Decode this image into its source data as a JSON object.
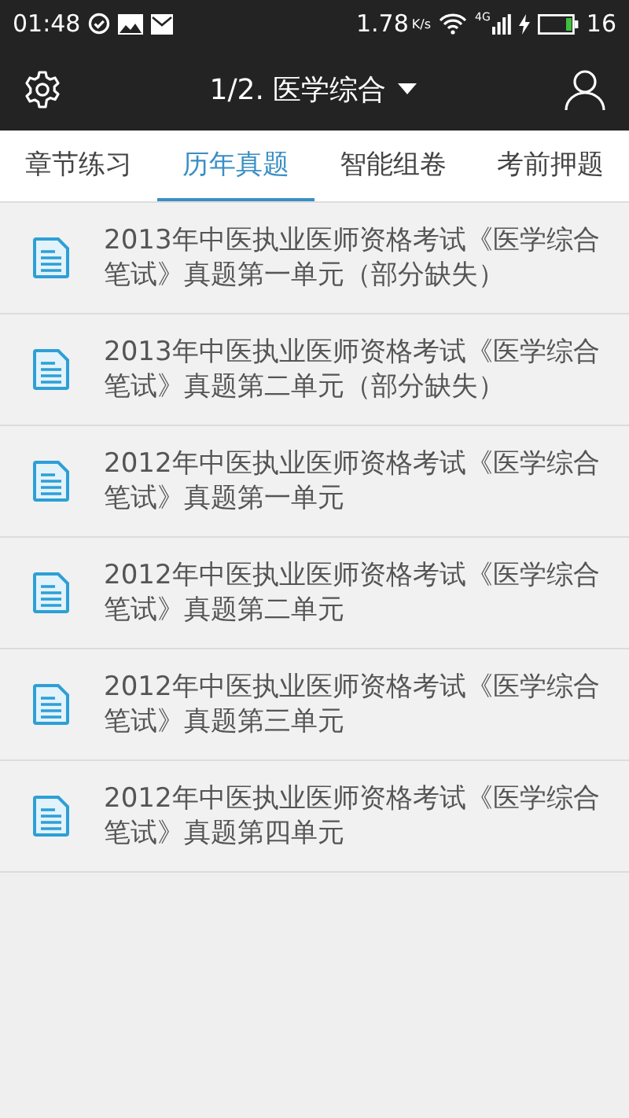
{
  "status_bar": {
    "time": "01:48",
    "speed": "1.78",
    "speed_unit": "K/s",
    "network": "4G",
    "battery": "16"
  },
  "header": {
    "title": "1/2. 医学综合"
  },
  "tabs": [
    {
      "label": "章节练习",
      "selected": false
    },
    {
      "label": "历年真题",
      "selected": true
    },
    {
      "label": "智能组卷",
      "selected": false
    },
    {
      "label": "考前押题",
      "selected": false
    }
  ],
  "items": [
    {
      "title": "2013年中医执业医师资格考试《医学综合笔试》真题第一单元（部分缺失）"
    },
    {
      "title": "2013年中医执业医师资格考试《医学综合笔试》真题第二单元（部分缺失）"
    },
    {
      "title": "2012年中医执业医师资格考试《医学综合笔试》真题第一单元"
    },
    {
      "title": "2012年中医执业医师资格考试《医学综合笔试》真题第二单元"
    },
    {
      "title": "2012年中医执业医师资格考试《医学综合笔试》真题第三单元"
    },
    {
      "title": "2012年中医执业医师资格考试《医学综合笔试》真题第四单元"
    }
  ]
}
